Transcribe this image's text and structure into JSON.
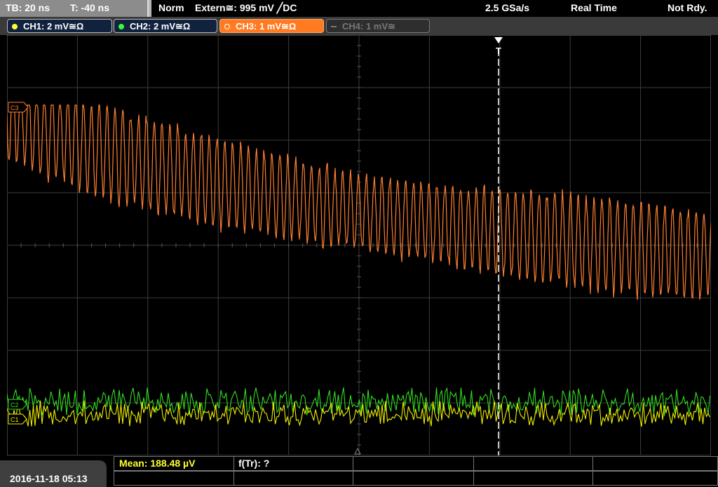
{
  "status": {
    "timebase": "TB: 20 ns",
    "trigger_offset": "T: -40 ns",
    "mode": "Norm",
    "trigger_source": "Extern≅: 995 mV ╱DC",
    "sample_rate": "2.5 GSa/s",
    "acq_mode": "Real Time",
    "ready_state": "Not Rdy."
  },
  "channels": [
    {
      "label": "CH1: 2 mV≅Ω",
      "color": "#ffff33",
      "active": true
    },
    {
      "label": "CH2: 2 mV≅Ω",
      "color": "#33ff33",
      "active": true
    },
    {
      "label": "CH3: 1 mV≅Ω",
      "color": "#ff6600",
      "active": true,
      "selected": true
    },
    {
      "label": "CH4: 1 mV≅",
      "color": "#777777",
      "active": false
    }
  ],
  "markers": {
    "ch3": "C3",
    "trigger": "T",
    "ch1": "C1",
    "ch2": "C2"
  },
  "measurements": {
    "mean": "Mean: 188.48 µV",
    "f_tr": "f(Tr): ?"
  },
  "footer": {
    "datetime": "2016-11-18 05:13"
  },
  "trace_colors": {
    "ch1": "#f0f000",
    "ch2": "#33dd22",
    "ch3": "#ff7f32"
  }
}
